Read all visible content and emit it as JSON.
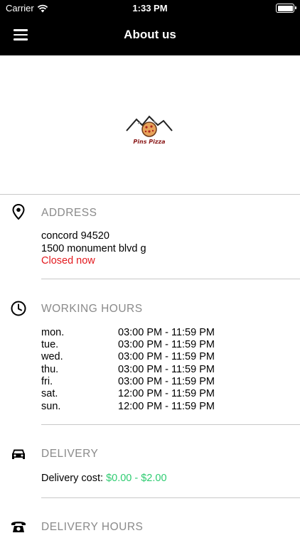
{
  "status_bar": {
    "carrier": "Carrier",
    "time": "1:33 PM"
  },
  "header": {
    "title": "About us"
  },
  "logo": {
    "text": "Pins Pizza"
  },
  "address": {
    "title": "ADDRESS",
    "line1": "concord 94520",
    "line2": "1500 monument blvd g",
    "status": "Closed now"
  },
  "working_hours": {
    "title": "WORKING HOURS",
    "rows": [
      {
        "day": "mon.",
        "hours": "03:00 PM - 11:59 PM"
      },
      {
        "day": "tue.",
        "hours": "03:00 PM - 11:59 PM"
      },
      {
        "day": "wed.",
        "hours": "03:00 PM - 11:59 PM"
      },
      {
        "day": "thu.",
        "hours": "03:00 PM - 11:59 PM"
      },
      {
        "day": "fri.",
        "hours": "03:00 PM - 11:59 PM"
      },
      {
        "day": "sat.",
        "hours": "12:00 PM - 11:59 PM"
      },
      {
        "day": "sun.",
        "hours": "12:00 PM - 11:59 PM"
      }
    ]
  },
  "delivery": {
    "title": "DELIVERY",
    "cost_label": "Delivery cost:",
    "cost_value": "$0.00 - $2.00"
  },
  "delivery_hours": {
    "title": "DELIVERY HOURS"
  },
  "colors": {
    "closed": "#e3191e",
    "cost": "#2ecc71",
    "section_title": "#8a8a8a"
  }
}
